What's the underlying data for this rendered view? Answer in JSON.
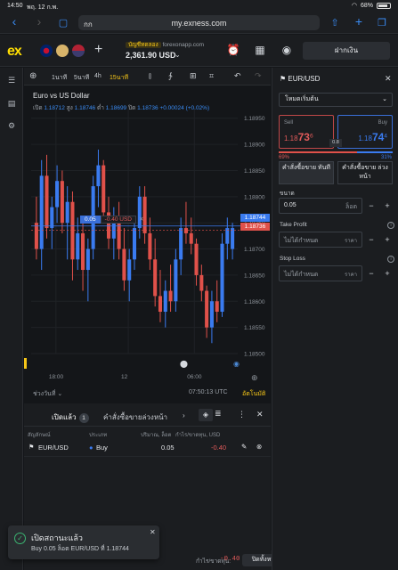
{
  "status_bar": {
    "time": "14:50",
    "date": "พฤ. 12 ก.พ.",
    "battery": "68%"
  },
  "browser": {
    "aa": "กก",
    "url": "my.exness.com"
  },
  "header": {
    "logo": "ex",
    "account_type": "บัญชีทดลอง",
    "account_host": "forexonapp.com",
    "balance": "2,361.90 USD",
    "deposit_label": "ฝากเงิน"
  },
  "chart_toolbar": {
    "timeframes": [
      "1นาที",
      "5นาที",
      "4h",
      "15นาที"
    ],
    "active_tf": "15นาที"
  },
  "chart": {
    "title": "Euro vs US Dollar",
    "ohlc": {
      "open_label": "เปิด",
      "open": "1.18712",
      "high_label": "สูง",
      "high": "1.18746",
      "low_label": "ต่ำ",
      "low": "1.18699",
      "close_label": "ปิด",
      "close": "1.18736",
      "change": "+0.00024 (+0.02%)"
    },
    "trade_tag": {
      "volume": "0.05",
      "pl": "-0.40 USD"
    },
    "price_ask": "1.18744",
    "price_bid": "1.18736",
    "session_label": "ช่วงวันที่",
    "clock": "07:50:13 UTC",
    "auto_label": "อัตโนมัติ"
  },
  "chart_data": {
    "type": "candlestick",
    "title": "Euro vs US Dollar",
    "yticks": [
      "1.18950",
      "1.18900",
      "1.18850",
      "1.18800",
      "1.18750",
      "1.18700",
      "1.18650",
      "1.18600",
      "1.18550",
      "1.18500"
    ],
    "xticks": [
      "18:00",
      "12",
      "06:00"
    ],
    "ylim": [
      1.185,
      1.1897
    ],
    "candles": [
      [
        1.1875,
        1.188,
        1.1868,
        1.187
      ],
      [
        1.187,
        1.1887,
        1.1866,
        1.1884
      ],
      [
        1.1884,
        1.1888,
        1.1872,
        1.1874
      ],
      [
        1.1874,
        1.188,
        1.187,
        1.1878
      ],
      [
        1.1878,
        1.1886,
        1.1875,
        1.1883
      ],
      [
        1.1883,
        1.1885,
        1.1873,
        1.1875
      ],
      [
        1.1875,
        1.1882,
        1.1868,
        1.1879
      ],
      [
        1.1879,
        1.1881,
        1.1864,
        1.1868
      ],
      [
        1.1868,
        1.1876,
        1.1866,
        1.1873
      ],
      [
        1.1873,
        1.1875,
        1.1862,
        1.1866
      ],
      [
        1.1866,
        1.1872,
        1.186,
        1.187
      ],
      [
        1.187,
        1.1884,
        1.1868,
        1.1882
      ],
      [
        1.1882,
        1.1889,
        1.1878,
        1.1886
      ],
      [
        1.1886,
        1.1887,
        1.1875,
        1.1877
      ],
      [
        1.1877,
        1.188,
        1.187,
        1.1872
      ],
      [
        1.1872,
        1.1878,
        1.1868,
        1.1876
      ],
      [
        1.1876,
        1.1879,
        1.1868,
        1.187
      ],
      [
        1.187,
        1.1874,
        1.1862,
        1.1864
      ],
      [
        1.1864,
        1.187,
        1.186,
        1.1868
      ],
      [
        1.1868,
        1.1876,
        1.1866,
        1.1874
      ],
      [
        1.1874,
        1.1882,
        1.1872,
        1.188
      ],
      [
        1.188,
        1.1882,
        1.1871,
        1.1873
      ],
      [
        1.1873,
        1.1876,
        1.1866,
        1.1868
      ],
      [
        1.1868,
        1.1872,
        1.1859,
        1.1861
      ],
      [
        1.1861,
        1.1866,
        1.1856,
        1.1858
      ],
      [
        1.1858,
        1.1864,
        1.1855,
        1.1862
      ],
      [
        1.1862,
        1.1867,
        1.1858,
        1.186
      ],
      [
        1.186,
        1.187,
        1.1858,
        1.1868
      ],
      [
        1.1868,
        1.1876,
        1.1865,
        1.1874
      ],
      [
        1.1874,
        1.1879,
        1.1871,
        1.1873
      ],
      [
        1.1873,
        1.1876,
        1.1869,
        1.1871
      ],
      [
        1.1871,
        1.1872,
        1.1863,
        1.1865
      ],
      [
        1.1865,
        1.1867,
        1.186,
        1.1862
      ],
      [
        1.1862,
        1.1863,
        1.1853,
        1.1855
      ],
      [
        1.1855,
        1.1862,
        1.1852,
        1.186
      ],
      [
        1.186,
        1.1864,
        1.1856,
        1.1858
      ],
      [
        1.1858,
        1.1873,
        1.1857,
        1.1871
      ],
      [
        1.1871,
        1.1876,
        1.1868,
        1.1874
      ],
      [
        1.187,
        1.1875,
        1.1868,
        1.1874
      ]
    ]
  },
  "positions": {
    "tab_open": "เปิดแล้ว",
    "open_count": "1",
    "tab_pending": "คำสั่งซื้อขายล่วงหน้า",
    "headers": {
      "symbol": "สัญลักษณ์",
      "type": "ประเภท",
      "volume": "ปริมาณ, ล็อต",
      "pl": "กำไร/ขาดทุน, USD"
    },
    "rows": [
      {
        "symbol": "EUR/USD",
        "type": "Buy",
        "volume": "0.05",
        "pl": "-0.40"
      }
    ],
    "total_label": "กำไร/ขาดทุน:",
    "total_pl": "-0.40",
    "close_all": "ปิดทั้งหมด"
  },
  "toast": {
    "title": "เปิดสถานะแล้ว",
    "message": "Buy 0.05 ล็อต EUR/USD ที่ 1.18744"
  },
  "order_panel": {
    "symbol": "EUR/USD",
    "mode": "โหมดเริ่มต้น",
    "sell_label": "Sell",
    "sell_price_prefix": "1.18",
    "sell_price_big": "73",
    "sell_price_sup": "6",
    "buy_label": "Buy",
    "buy_price_prefix": "1.18",
    "buy_price_big": "74",
    "buy_price_sup": "4",
    "spread": "0.8",
    "sell_pct": "69%",
    "buy_pct": "31%",
    "sell_sentiment": 0.69,
    "order_market": "คำสั่งซื้อขาย ทันที",
    "order_pending": "คำสั่งซื้อขาย ล่วงหน้า",
    "volume_label": "ขนาด",
    "volume_value": "0.05",
    "volume_unit": "ล็อต",
    "tp_label": "Take Profit",
    "tp_value": "ไม่ได้กำหนด",
    "tp_unit": "ราคา",
    "sl_label": "Stop Loss",
    "sl_value": "ไม่ได้กำหนด",
    "sl_unit": "ราคา"
  },
  "colors": {
    "bull": "#3a7bf0",
    "bear": "#e0514a",
    "accent": "#f5c518"
  }
}
